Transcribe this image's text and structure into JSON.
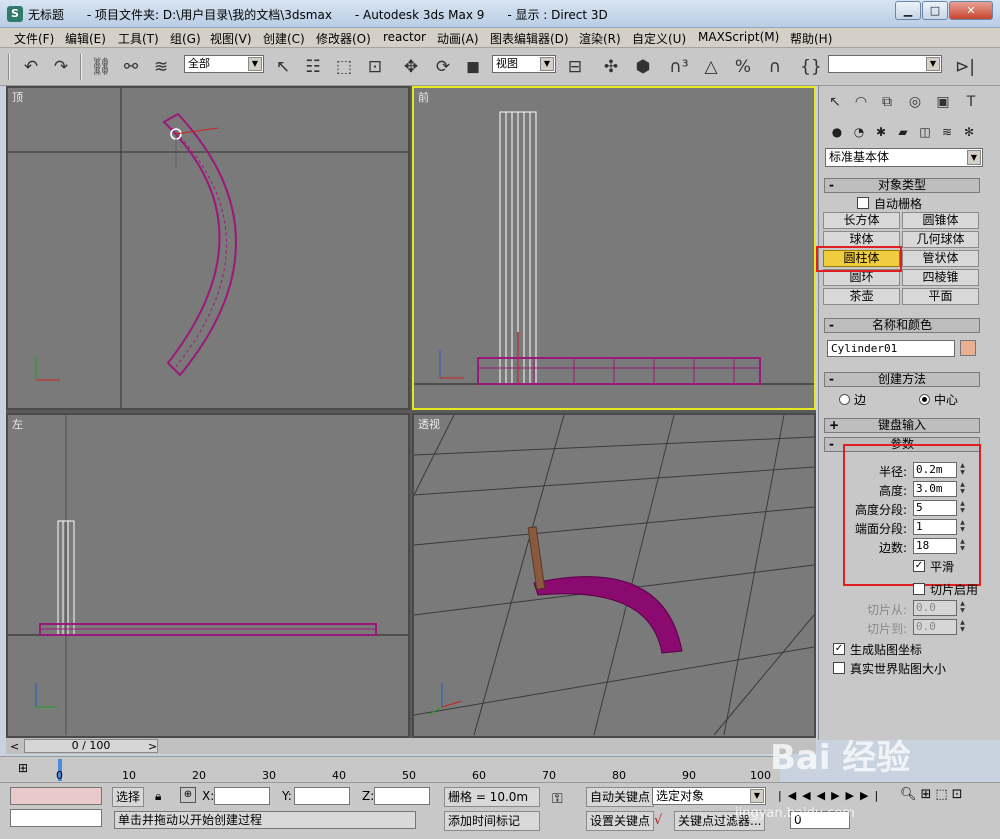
{
  "window": {
    "app_icon": "S",
    "title": "无标题      - 项目文件夹: D:\\用户目录\\我的文档\\3dsmax      - Autodesk 3ds Max 9      - 显示 : Direct 3D",
    "minimize": "▁",
    "maximize": "□",
    "close": "✕"
  },
  "menu": [
    "文件(F)",
    "编辑(E)",
    "工具(T)",
    "组(G)",
    "视图(V)",
    "创建(C)",
    "修改器(O)",
    "reactor",
    "动画(A)",
    "图表编辑器(D)",
    "渲染(R)",
    "自定义(U)",
    "MAXScript(M)",
    "帮助(H)"
  ],
  "toolbar": {
    "selection_filter": "全部",
    "coord_system": "视图",
    "undo_icon": "undo-icon",
    "redo_icon": "redo-icon"
  },
  "viewports": {
    "top": "顶",
    "front": "前",
    "left": "左",
    "perspective": "透视"
  },
  "command_panel": {
    "category": "标准基本体",
    "object_type_title": "对象类型",
    "auto_grid": "自动栅格",
    "object_buttons": [
      "长方体",
      "圆锥体",
      "球体",
      "几何球体",
      "圆柱体",
      "管状体",
      "圆环",
      "四棱锥",
      "茶壶",
      "平面"
    ],
    "selected_button": "圆柱体",
    "name_color_title": "名称和颜色",
    "object_name": "Cylinder01",
    "object_color": "#e8b090",
    "creation_method_title": "创建方法",
    "method_edge": "边",
    "method_center": "中心",
    "keyboard_entry_title": "键盘输入",
    "params_title": "参数",
    "params": {
      "radius_label": "半径:",
      "radius": "0.2m",
      "height_label": "高度:",
      "height": "3.0m",
      "height_segs_label": "高度分段:",
      "height_segs": "5",
      "cap_segs_label": "端面分段:",
      "cap_segs": "1",
      "sides_label": "边数:",
      "sides": "18",
      "smooth": "平滑",
      "slice_on": "切片启用",
      "slice_from_label": "切片从:",
      "slice_from": "0.0",
      "slice_to_label": "切片到:",
      "slice_to": "0.0",
      "gen_mapping": "生成贴图坐标",
      "real_world": "真实世界贴图大小"
    }
  },
  "timeline": {
    "frame": "0 / 100",
    "ticks": [
      "0",
      "10",
      "20",
      "30",
      "40",
      "50",
      "60",
      "70",
      "80",
      "90",
      "100"
    ]
  },
  "status": {
    "select_label": "选择",
    "x_label": "X:",
    "y_label": "Y:",
    "z_label": "Z:",
    "grid": "栅格 = 10.0m",
    "auto_key": "自动关键点",
    "set_key": "设置关键点",
    "selected_object": "选定对象",
    "key_filters": "关键点过滤器...",
    "prompt": "单击并拖动以开始创建过程",
    "add_time_tag": "添加时间标记",
    "frame_value": "0"
  },
  "watermark": {
    "main": "Bai 经验",
    "sub": "jingyan.baidu.com"
  },
  "colors": {
    "active_viewport": "#e8e820",
    "object_magenta": "#9a1a7a",
    "highlight_red": "#e02020"
  }
}
